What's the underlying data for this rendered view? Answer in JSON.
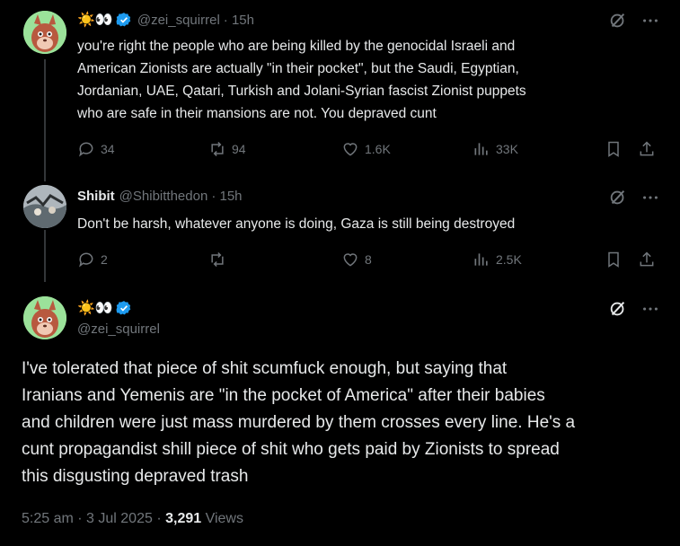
{
  "tweet1": {
    "emoji": "☀️👀",
    "handle": "@zei_squirrel",
    "time": "· 15h",
    "text_lines": [
      "you're right the people who are being killed by the genocidal Israeli and",
      "American Zionists are actually \"in their pocket\", but the Saudi, Egyptian,",
      "Jordanian, UAE, Qatari, Turkish and Jolani-Syrian fascist Zionist puppets",
      "who are safe in their mansions are not. You depraved cunt"
    ],
    "replies": "34",
    "reposts": "94",
    "likes": "1.6K",
    "views": "33K"
  },
  "tweet2": {
    "name": "Shibit",
    "handle": "@Shibitthedon",
    "time": "· 15h",
    "text": "Don't be harsh, whatever anyone is doing, Gaza is still being destroyed",
    "replies": "2",
    "reposts": "",
    "likes": "8",
    "views": "2.5K"
  },
  "main_tweet": {
    "emoji": "☀️👀",
    "handle": "@zei_squirrel",
    "text_lines": [
      "I've tolerated that piece of shit scumfuck enough, but saying that",
      "Iranians and Yemenis are \"in the pocket of America\" after their babies",
      "and children were just mass murdered by them crosses every line. He's a",
      "cunt propagandist shill piece of shit who gets paid by Zionists to spread",
      "this disgusting depraved trash"
    ],
    "timestamp": "5:25 am · 3 Jul 2025 · ",
    "view_count": "3,291",
    "views_label": " Views"
  },
  "colors": {
    "background": "#000000",
    "text": "#e7e9ea",
    "muted": "#71767b",
    "verified": "#1d9bf0",
    "thread_line": "#333639"
  }
}
